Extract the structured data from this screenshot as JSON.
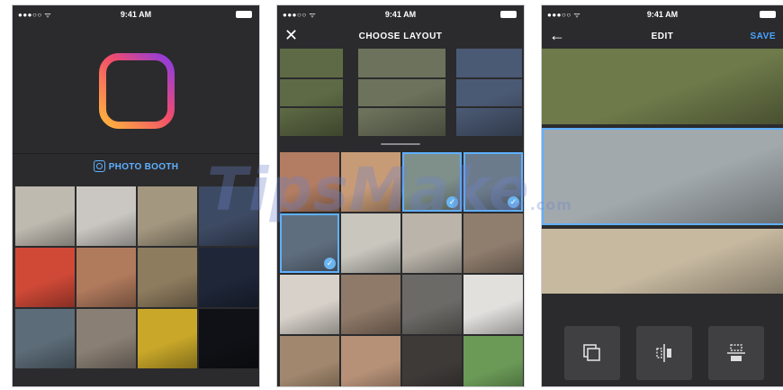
{
  "status_bar": {
    "signal": "●●●○○ ᯤ",
    "time": "9:41 AM"
  },
  "screen_booth": {
    "photo_booth_label": "PHOTO BOOTH",
    "logo_gradient": [
      "#ffb63d",
      "#f24c6b",
      "#8a3be4"
    ],
    "grid_colors": [
      "#bfbab0",
      "#cac7c2",
      "#a3977f",
      "#3d4a63",
      "#d04937",
      "#b07a5d",
      "#8e7c5e",
      "#1e2638",
      "#5c6c78",
      "#8a7f74",
      "#c9a829",
      "#0f1116"
    ]
  },
  "screen_layout": {
    "title": "CHOOSE LAYOUT",
    "close_glyph": "✕",
    "check_glyph": "✓",
    "strip_colors": [
      "#5e6a45",
      "#6d725c",
      "#4b5a74"
    ],
    "grid_colors": [
      "#b27d62",
      "#c89b77",
      "#7f8f8a",
      "#6c7b8c",
      "#5f6e7f",
      "#c8c6bd",
      "#bab4aa",
      "#8f7d6e",
      "#d7d1c9",
      "#8f7968",
      "#6c6a66",
      "#e2e0dd",
      "#a1876d",
      "#b69178",
      "#3e3a38",
      "#6b9a57"
    ]
  },
  "screen_edit": {
    "title": "EDIT",
    "back_glyph": "←",
    "save_label": "SAVE",
    "panel_colors": [
      "#6e7a4a",
      "#a2a9ad",
      "#c7b9a0"
    ]
  },
  "watermark": {
    "text": "TipsMake",
    "suffix": ".com"
  }
}
